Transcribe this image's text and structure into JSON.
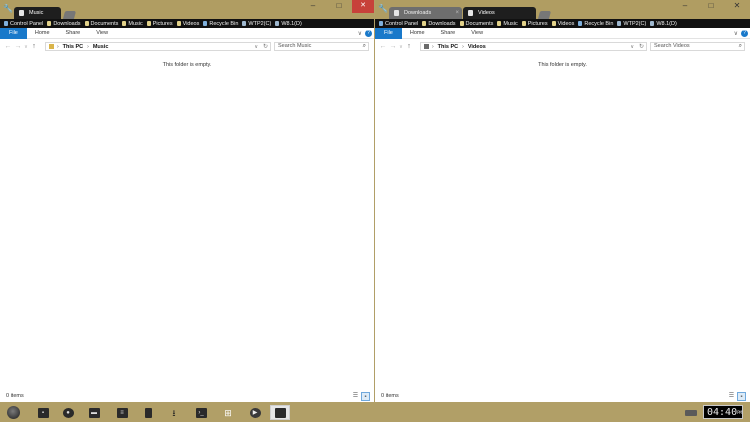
{
  "left_window": {
    "tabs": [
      {
        "label": "Music"
      }
    ],
    "favorites": [
      {
        "label": "Control Panel"
      },
      {
        "label": "Downloads"
      },
      {
        "label": "Documents"
      },
      {
        "label": "Music"
      },
      {
        "label": "Pictures"
      },
      {
        "label": "Videos"
      },
      {
        "label": "Recycle Bin"
      },
      {
        "label": "WTP2(C)"
      },
      {
        "label": "W8.1(D)"
      }
    ],
    "ribbon_tabs": [
      "File",
      "Home",
      "Share",
      "View"
    ],
    "breadcrumb": [
      "This PC",
      "Music"
    ],
    "search_placeholder": "Search Music",
    "empty_message": "This folder is empty.",
    "status_count": "0 items"
  },
  "right_window": {
    "tabs": [
      {
        "label": "Downloads"
      },
      {
        "label": "Videos"
      }
    ],
    "favorites": [
      {
        "label": "Control Panel"
      },
      {
        "label": "Downloads"
      },
      {
        "label": "Documents"
      },
      {
        "label": "Music"
      },
      {
        "label": "Pictures"
      },
      {
        "label": "Videos"
      },
      {
        "label": "Recycle Bin"
      },
      {
        "label": "WTP2(C)"
      },
      {
        "label": "W8.1(D)"
      }
    ],
    "ribbon_tabs": [
      "File",
      "Home",
      "Share",
      "View"
    ],
    "breadcrumb": [
      "This PC",
      "Videos"
    ],
    "search_placeholder": "Search Videos",
    "empty_message": "This folder is empty.",
    "status_count": "0 items"
  },
  "taskbar": {
    "clock_time": "04:40",
    "clock_ampm": "PM"
  },
  "colors": {
    "desktop": "#b19f67",
    "accent": "#1979ca",
    "close_button": "#c7413a"
  }
}
